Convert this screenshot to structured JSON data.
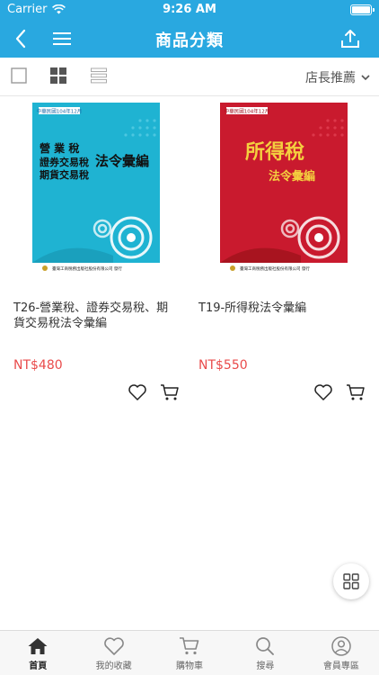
{
  "status_bar": {
    "carrier": "Carrier",
    "time": "9:26 AM"
  },
  "nav": {
    "title": "商品分類",
    "back_icon": "chevron-left-icon",
    "menu_icon": "menu-icon",
    "share_icon": "share-icon"
  },
  "toolbar": {
    "sort_label": "店長推薦",
    "views": [
      "checkbox",
      "grid-view-icon",
      "list-view-icon"
    ]
  },
  "products": [
    {
      "name": "T26-營業稅、證券交易稅、期貨交易稅法令彙編",
      "price": "NT$480",
      "cover": {
        "top_tag": "中華民國104年12月",
        "line1": "營  業  稅",
        "line2": "證券交易稅",
        "line3": "期貨交易稅",
        "side": "法令彙編",
        "publisher": "臺灣工商稅務出版社股份有限公司   發行",
        "bg": "#1fb3d2"
      }
    },
    {
      "name": "T19-所得稅法令彙編",
      "price": "NT$550",
      "cover": {
        "top_tag": "中華民國104年12月",
        "line1": "所得稅",
        "side": "法令彙編",
        "publisher": "臺灣工商稅務出版社股份有限公司   發行",
        "bg": "#c91a2e"
      }
    }
  ],
  "tabs": [
    {
      "label": "首頁",
      "icon": "home-icon",
      "active": true
    },
    {
      "label": "我的收藏",
      "icon": "heart-icon",
      "active": false
    },
    {
      "label": "購物車",
      "icon": "cart-icon",
      "active": false
    },
    {
      "label": "搜尋",
      "icon": "search-icon",
      "active": false
    },
    {
      "label": "會員專區",
      "icon": "user-icon",
      "active": false
    }
  ],
  "colors": {
    "brand": "#29a8e0",
    "price": "#e94b4b"
  }
}
